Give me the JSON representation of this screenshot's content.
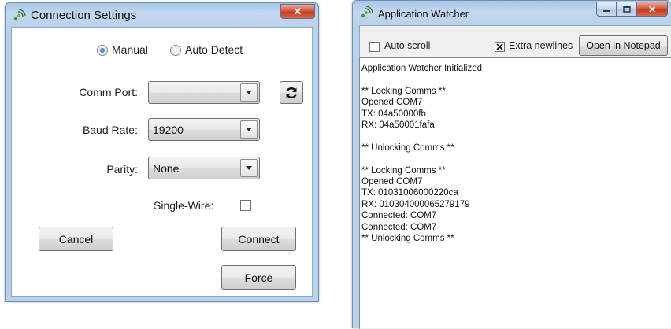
{
  "connection_settings": {
    "title": "Connection Settings",
    "close_glyph": "✕",
    "mode": {
      "manual_label": "Manual",
      "auto_label": "Auto Detect",
      "selected": "Manual"
    },
    "comm_port": {
      "label": "Comm Port:",
      "value": ""
    },
    "baud_rate": {
      "label": "Baud Rate:",
      "value": "19200"
    },
    "parity": {
      "label": "Parity:",
      "value": "None"
    },
    "single_wire": {
      "label": "Single-Wire:",
      "checked": false
    },
    "refresh_icon": "refresh-icon",
    "buttons": {
      "cancel": "Cancel",
      "connect": "Connect",
      "force": "Force"
    }
  },
  "app_watcher": {
    "title": "Application Watcher",
    "close_glyph": "✕",
    "auto_scroll": {
      "label": "Auto scroll",
      "checked": false
    },
    "extra_newlines": {
      "label": "Extra newlines",
      "checked": true
    },
    "open_notepad_label": "Open in Notepad",
    "log_text": "Application Watcher Initialized\n\n** Locking Comms **\nOpened COM7\nTX: 04a50000fb\nRX: 04a50001fafa\n\n** Unlocking Comms **\n\n** Locking Comms **\nOpened COM7\nTX: 01031006000220ca\nRX: 010304000065279179\nConnected: COM7\nConnected: COM7\n** Unlocking Comms **"
  },
  "colors": {
    "title_gradient": "#b9d1ea",
    "close_button": "#c53a22",
    "radio_selected": "#1f62b7"
  }
}
